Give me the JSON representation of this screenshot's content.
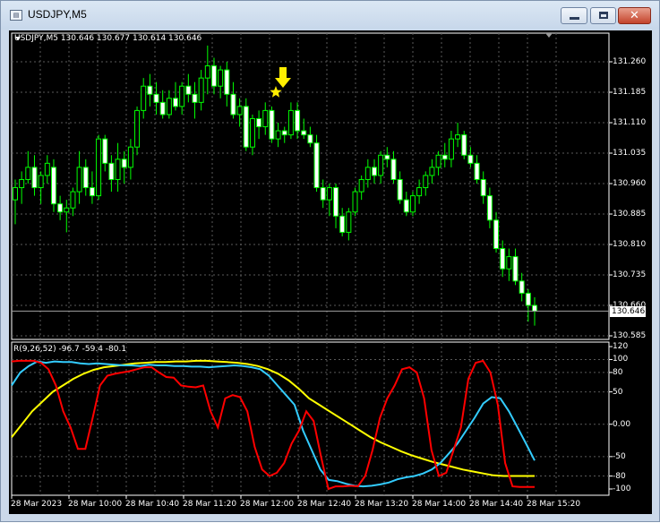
{
  "window": {
    "title": "USDJPY,M5",
    "icon": "chart-window-icon",
    "buttons": [
      "minimize-icon",
      "maximize-icon",
      "close-icon"
    ]
  },
  "chart": {
    "header_label": "USDJPY,M5  130.646 130.677 130.614 130.646",
    "current_price": "130.646",
    "bull_color": "#00ff00",
    "bear_color": "#000000",
    "grid_color": "#5a5a5a",
    "price_scale": [
      "131.260",
      "131.185",
      "131.110",
      "131.035",
      "130.960",
      "130.885",
      "130.810",
      "130.735",
      "130.660",
      "130.585"
    ],
    "markers": [
      {
        "type": "arrow-down",
        "color": "#ffee00"
      },
      {
        "type": "star",
        "color": "#ffee00"
      }
    ]
  },
  "indicator": {
    "label": "R(9,26,52) -96.7 -59.4 -80.1",
    "scale": [
      "120",
      "100",
      "80",
      "50",
      "0.00",
      "-50",
      "-80",
      "-100"
    ],
    "line_colors": {
      "fast": "#ff0000",
      "mid": "#33ccff",
      "slow": "#ffff00"
    }
  },
  "time_axis": [
    "28 Mar 2023",
    "28 Mar 10:00",
    "28 Mar 10:40",
    "28 Mar 11:20",
    "28 Mar 12:00",
    "28 Mar 12:40",
    "28 Mar 13:20",
    "28 Mar 14:00",
    "28 Mar 14:40",
    "28 Mar 15:20"
  ],
  "chart_data": {
    "type": "candlestick",
    "title": "USDJPY,M5",
    "y_range": [
      130.585,
      131.26
    ],
    "candles": [
      [
        130.92,
        130.97,
        130.86,
        130.95
      ],
      [
        130.95,
        130.99,
        130.91,
        130.97
      ],
      [
        130.97,
        131.04,
        130.96,
        131.0
      ],
      [
        131.0,
        131.03,
        130.93,
        130.95
      ],
      [
        130.95,
        130.99,
        130.91,
        130.98
      ],
      [
        130.98,
        131.03,
        130.96,
        131.01
      ],
      [
        131.0,
        131.02,
        130.89,
        130.91
      ],
      [
        130.91,
        130.93,
        130.87,
        130.89
      ],
      [
        130.89,
        130.92,
        130.84,
        130.9
      ],
      [
        130.9,
        130.95,
        130.88,
        130.94
      ],
      [
        130.94,
        131.04,
        130.91,
        131.0
      ],
      [
        131.0,
        131.02,
        130.93,
        130.95
      ],
      [
        130.95,
        130.99,
        130.91,
        130.93
      ],
      [
        130.93,
        131.08,
        130.92,
        131.07
      ],
      [
        131.07,
        131.08,
        130.99,
        131.01
      ],
      [
        131.01,
        131.03,
        130.94,
        130.97
      ],
      [
        130.97,
        131.06,
        130.94,
        131.02
      ],
      [
        131.02,
        131.04,
        130.96,
        131.0
      ],
      [
        131.0,
        131.07,
        130.97,
        131.05
      ],
      [
        131.05,
        131.15,
        131.03,
        131.14
      ],
      [
        131.14,
        131.22,
        131.12,
        131.2
      ],
      [
        131.2,
        131.23,
        131.15,
        131.18
      ],
      [
        131.18,
        131.21,
        131.13,
        131.16
      ],
      [
        131.16,
        131.19,
        131.12,
        131.13
      ],
      [
        131.13,
        131.19,
        131.12,
        131.17
      ],
      [
        131.17,
        131.21,
        131.14,
        131.15
      ],
      [
        131.15,
        131.21,
        131.13,
        131.2
      ],
      [
        131.2,
        131.23,
        131.16,
        131.18
      ],
      [
        131.18,
        131.21,
        131.12,
        131.16
      ],
      [
        131.16,
        131.24,
        131.14,
        131.22
      ],
      [
        131.22,
        131.3,
        131.18,
        131.25
      ],
      [
        131.25,
        131.27,
        131.18,
        131.2
      ],
      [
        131.2,
        131.25,
        131.17,
        131.24
      ],
      [
        131.24,
        131.26,
        131.15,
        131.18
      ],
      [
        131.18,
        131.21,
        131.12,
        131.13
      ],
      [
        131.13,
        131.17,
        131.1,
        131.15
      ],
      [
        131.15,
        131.17,
        131.04,
        131.05
      ],
      [
        131.05,
        131.13,
        131.03,
        131.12
      ],
      [
        131.12,
        131.14,
        131.07,
        131.1
      ],
      [
        131.1,
        131.16,
        131.08,
        131.14
      ],
      [
        131.14,
        131.15,
        131.06,
        131.07
      ],
      [
        131.07,
        131.11,
        131.05,
        131.09
      ],
      [
        131.09,
        131.1,
        131.06,
        131.08
      ],
      [
        131.08,
        131.16,
        131.07,
        131.14
      ],
      [
        131.14,
        131.16,
        131.07,
        131.09
      ],
      [
        131.09,
        131.12,
        131.07,
        131.08
      ],
      [
        131.08,
        131.1,
        131.05,
        131.06
      ],
      [
        131.06,
        131.08,
        130.94,
        130.95
      ],
      [
        130.95,
        130.97,
        130.9,
        130.92
      ],
      [
        130.92,
        130.96,
        130.88,
        130.95
      ],
      [
        130.95,
        130.96,
        130.85,
        130.88
      ],
      [
        130.88,
        130.9,
        130.83,
        130.84
      ],
      [
        130.84,
        130.9,
        130.82,
        130.89
      ],
      [
        130.89,
        130.95,
        130.88,
        130.94
      ],
      [
        130.94,
        130.98,
        130.92,
        130.97
      ],
      [
        130.97,
        131.02,
        130.95,
        131.0
      ],
      [
        131.0,
        131.02,
        130.96,
        130.98
      ],
      [
        130.98,
        131.04,
        130.96,
        131.03
      ],
      [
        131.03,
        131.05,
        131.0,
        131.02
      ],
      [
        131.02,
        131.04,
        130.96,
        130.97
      ],
      [
        130.97,
        130.99,
        130.91,
        130.92
      ],
      [
        130.92,
        130.94,
        130.88,
        130.89
      ],
      [
        130.89,
        130.94,
        130.88,
        130.93
      ],
      [
        130.93,
        130.97,
        130.91,
        130.95
      ],
      [
        130.95,
        130.99,
        130.93,
        130.98
      ],
      [
        130.98,
        131.02,
        130.96,
        131.0
      ],
      [
        131.0,
        131.04,
        130.98,
        131.03
      ],
      [
        131.03,
        131.06,
        131.0,
        131.02
      ],
      [
        131.02,
        131.09,
        131.0,
        131.07
      ],
      [
        131.07,
        131.11,
        131.05,
        131.08
      ],
      [
        131.08,
        131.09,
        131.02,
        131.03
      ],
      [
        131.03,
        131.05,
        131.0,
        131.01
      ],
      [
        131.01,
        131.03,
        130.96,
        130.97
      ],
      [
        130.97,
        130.99,
        130.91,
        130.93
      ],
      [
        130.93,
        130.95,
        130.85,
        130.87
      ],
      [
        130.87,
        130.89,
        130.79,
        130.8
      ],
      [
        130.8,
        130.82,
        130.73,
        130.75
      ],
      [
        130.75,
        130.8,
        130.72,
        130.78
      ],
      [
        130.78,
        130.8,
        130.71,
        130.72
      ],
      [
        130.72,
        130.74,
        130.67,
        130.69
      ],
      [
        130.69,
        130.7,
        130.62,
        130.66
      ],
      [
        130.66,
        130.68,
        130.61,
        130.646
      ]
    ],
    "indicator_series": {
      "fast": [
        97,
        98,
        98,
        98,
        95,
        85,
        60,
        20,
        -5,
        -38,
        -38,
        10,
        60,
        75,
        78,
        80,
        82,
        85,
        88,
        88,
        80,
        73,
        72,
        60,
        58,
        57,
        60,
        20,
        -5,
        40,
        45,
        42,
        20,
        -35,
        -70,
        -80,
        -75,
        -60,
        -30,
        -10,
        20,
        5,
        -50,
        -100,
        -96,
        -96,
        -95,
        -96,
        -80,
        -40,
        10,
        40,
        60,
        85,
        88,
        80,
        40,
        -40,
        -80,
        -75,
        -40,
        -5,
        70,
        95,
        98,
        80,
        30,
        -60,
        -96,
        -97,
        -97,
        -97
      ],
      "mid": [
        60,
        80,
        90,
        97,
        95,
        97,
        96,
        96,
        94,
        93,
        94,
        93,
        92,
        91,
        91,
        90,
        92,
        91,
        91,
        90,
        90,
        89,
        89,
        88,
        89,
        90,
        91,
        90,
        88,
        85,
        75,
        60,
        45,
        30,
        -10,
        -40,
        -70,
        -86,
        -88,
        -92,
        -95,
        -96,
        -95,
        -93,
        -90,
        -85,
        -82,
        -80,
        -76,
        -70,
        -60,
        -45,
        -30,
        -10,
        10,
        32,
        42,
        40,
        20,
        -5,
        -30,
        -56
      ],
      "slow": [
        -20,
        0,
        20,
        35,
        50,
        60,
        70,
        78,
        84,
        88,
        90,
        92,
        94,
        95,
        96,
        96,
        97,
        97,
        98,
        98,
        97,
        96,
        95,
        93,
        90,
        85,
        78,
        68,
        55,
        40,
        30,
        20,
        10,
        0,
        -10,
        -20,
        -28,
        -35,
        -42,
        -48,
        -53,
        -58,
        -62,
        -66,
        -70,
        -73,
        -76,
        -79,
        -80,
        -80,
        -80,
        -80
      ]
    },
    "indicator_range": [
      -100,
      120
    ]
  }
}
